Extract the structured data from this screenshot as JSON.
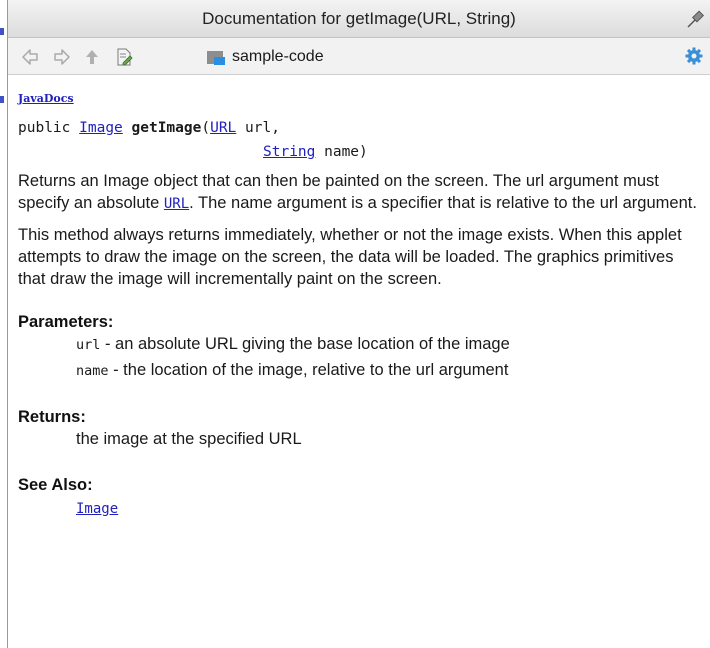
{
  "window": {
    "title": "Documentation for getImage(URL, String)"
  },
  "toolbar": {
    "buttons": [
      "back-arrow-icon",
      "forward-arrow-icon",
      "up-arrow-icon",
      "edit-source-icon"
    ],
    "module_label": "sample-code",
    "module_icon": "module-folder-icon",
    "settings_icon": "gear-icon"
  },
  "doc": {
    "javadocs_link": "JavaDocs",
    "signature": {
      "modifier": "public",
      "return_type": "Image",
      "method_name": "getImage",
      "open_paren": "(",
      "param1_type": "URL",
      "param1_rest": " url,",
      "param2_type": "String",
      "param2_rest": " name)"
    },
    "description_1": {
      "before_link": "Returns an Image object that can then be painted on the screen. The url argument must specify an absolute ",
      "link": "URL",
      "after_link": ". The name argument is a specifier that is relative to the url argument."
    },
    "description_2": "This method always returns immediately, whether or not the image exists. When this applet attempts to draw the image on the screen, the data will be loaded. The graphics primitives that draw the image will incrementally paint on the screen.",
    "parameters": {
      "title": "Parameters:",
      "items": [
        {
          "name": "url",
          "desc": " - an absolute URL giving the base location of the image"
        },
        {
          "name": "name",
          "desc": " - the location of the image, relative to the url argument"
        }
      ]
    },
    "returns": {
      "title": "Returns:",
      "text": "the image at the specified URL"
    },
    "see_also": {
      "title": "See Also:",
      "link": "Image"
    }
  },
  "colors": {
    "link": "#2020c0",
    "title_bar": "#e6e6e6",
    "toolbar": "#f2f2f2",
    "module_icon_blue": "#2a8fe0",
    "gear_blue": "#3b8fd6"
  }
}
